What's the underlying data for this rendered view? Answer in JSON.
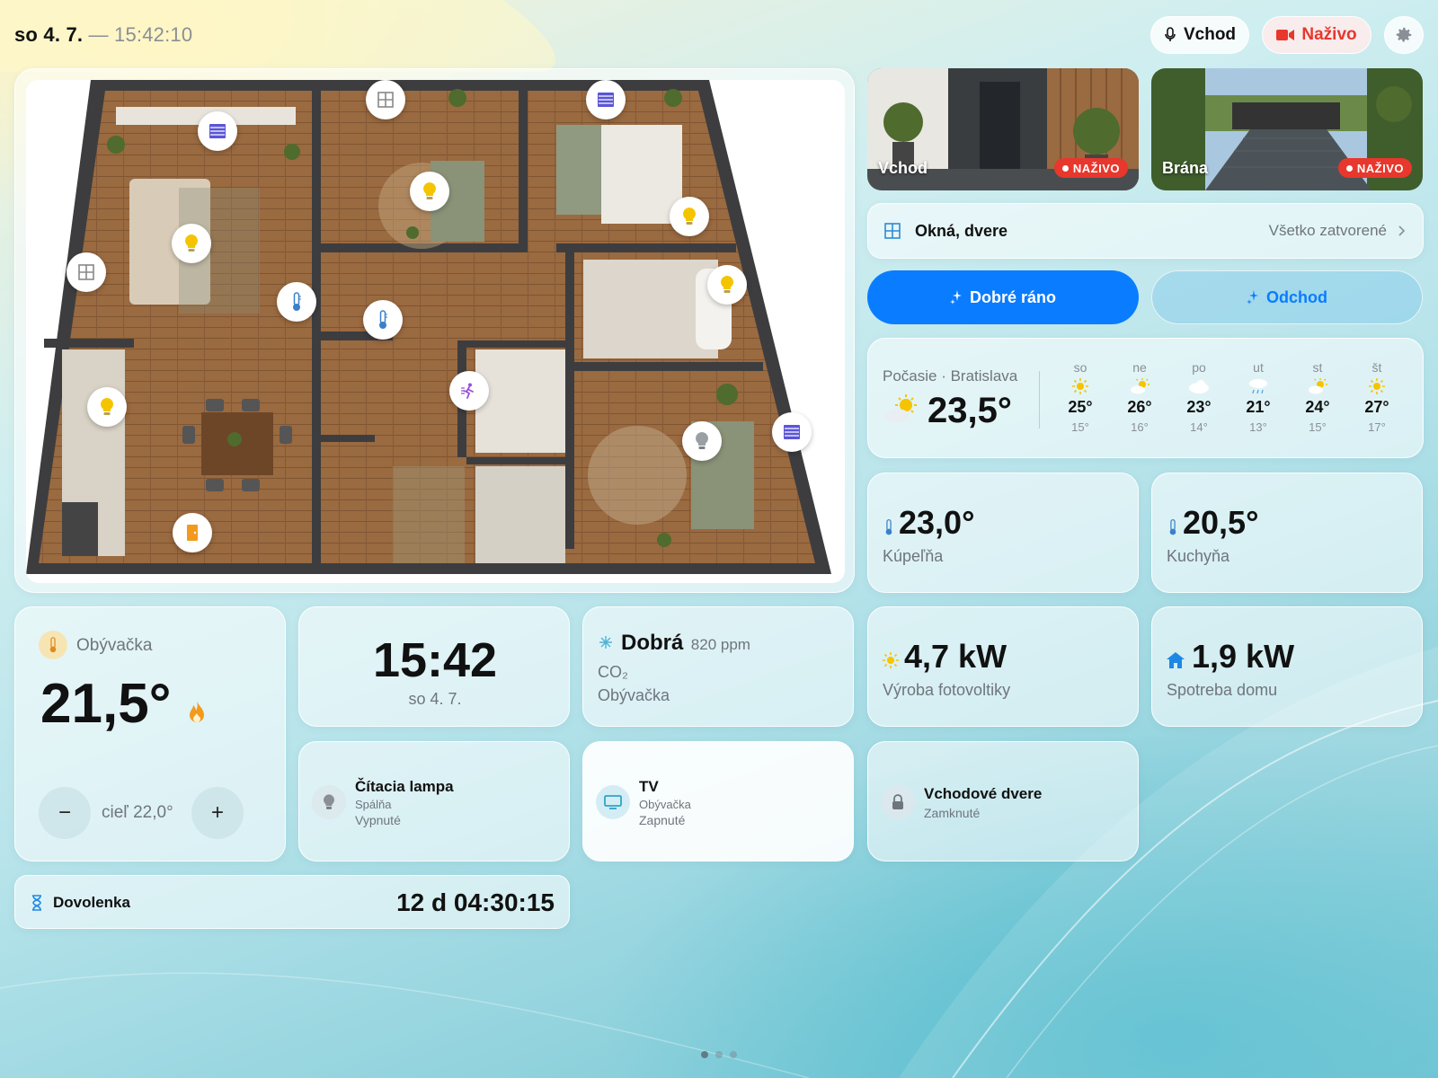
{
  "header": {
    "date": "so 4. 7.",
    "separator": "—",
    "time": "15:42:10",
    "btn_entrance": "Vchod",
    "btn_live": "Naživo"
  },
  "cameras": [
    {
      "label": "Vchod",
      "badge": "NAŽIVO"
    },
    {
      "label": "Brána",
      "badge": "NAŽIVO"
    }
  ],
  "windows_row": {
    "label": "Okná, dvere",
    "status": "Všetko zatvorené"
  },
  "scenes": [
    {
      "label": "Dobré ráno"
    },
    {
      "label": "Odchod"
    }
  ],
  "weather": {
    "title": "Počasie · Bratislava",
    "current_temp": "23,5°",
    "days": [
      {
        "name": "so",
        "icon": "sun-icon",
        "high": "25°",
        "low": "15°"
      },
      {
        "name": "ne",
        "icon": "sun-cloud-icon",
        "high": "26°",
        "low": "16°"
      },
      {
        "name": "po",
        "icon": "cloud-icon",
        "high": "23°",
        "low": "14°"
      },
      {
        "name": "ut",
        "icon": "rain-icon",
        "high": "21°",
        "low": "13°"
      },
      {
        "name": "st",
        "icon": "sun-cloud-icon",
        "high": "24°",
        "low": "15°"
      },
      {
        "name": "št",
        "icon": "sun-icon",
        "high": "27°",
        "low": "17°"
      }
    ]
  },
  "temps": [
    {
      "value": "23,0°",
      "room": "Kúpeľňa"
    },
    {
      "value": "20,5°",
      "room": "Kuchyňa"
    }
  ],
  "energy": [
    {
      "value": "4,7 kW",
      "label": "Výroba fotovoltiky"
    },
    {
      "value": "1,9 kW",
      "label": "Spotreba domu"
    }
  ],
  "thermostat": {
    "room": "Obývačka",
    "temp": "21,5°",
    "minus": "−",
    "target": "cieľ 22,0°",
    "plus": "+"
  },
  "clock": {
    "time": "15:42",
    "date": "so 4. 7."
  },
  "co2": {
    "quality": "Dobrá",
    "ppm": "820 ppm",
    "label": "CO₂",
    "room": "Obývačka"
  },
  "devices": [
    {
      "name": "Čítacia lampa",
      "room": "Spálňa",
      "state": "Vypnuté"
    },
    {
      "name": "TV",
      "room": "Obývačka",
      "state": "Zapnuté"
    },
    {
      "name": "Vchodové dvere",
      "state": "Zamknuté"
    }
  ],
  "vacation": {
    "label": "Dovolenka",
    "countdown": "12 d 04:30:15"
  },
  "colors": {
    "accent": "#0a7cff",
    "live": "#e8372d",
    "bulb": "#f5c400",
    "flame": "#f39a1e"
  }
}
